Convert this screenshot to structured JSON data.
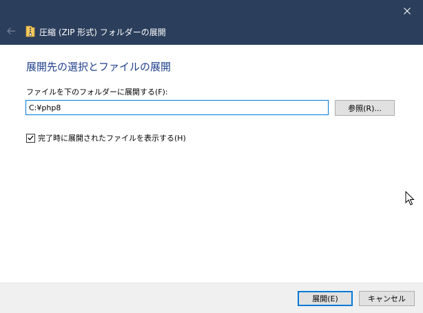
{
  "titlebar": {
    "title": "圧縮 (ZIP 形式) フォルダーの展開",
    "close_icon": "close-icon",
    "back_icon": "back-arrow-icon",
    "folder_icon": "zip-folder-icon",
    "background_color": "#2b3e5c"
  },
  "main": {
    "heading": "展開先の選択とファイルの展開",
    "destination_label": "ファイルを下のフォルダーに展開する(F):",
    "destination_value": "C:¥php8",
    "browse_label": "参照(R)...",
    "checkbox_label": "完了時に展開されたファイルを表示する(H)",
    "checkbox_checked": true,
    "heading_color": "#1f3f8c"
  },
  "footer": {
    "extract_label": "展開(E)",
    "cancel_label": "キャンセル"
  }
}
